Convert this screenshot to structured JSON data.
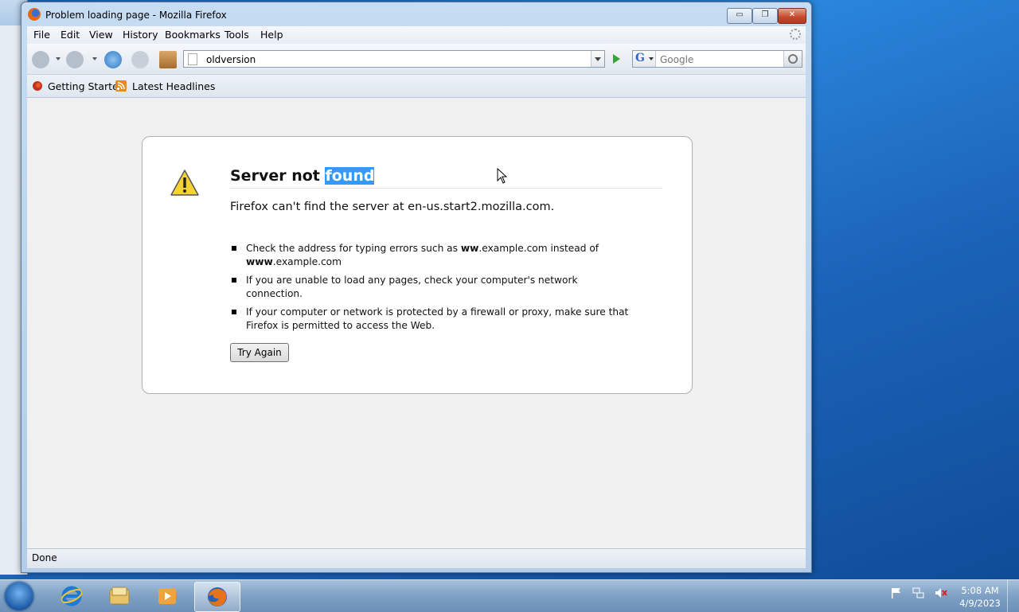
{
  "window": {
    "title": "Problem loading page - Mozilla Firefox",
    "controls": {
      "minimize": "▭",
      "maximize": "❐",
      "close": "✕"
    }
  },
  "menubar": {
    "items": [
      "File",
      "Edit",
      "View",
      "History",
      "Bookmarks",
      "Tools",
      "Help"
    ]
  },
  "navbar": {
    "url": "oldversion",
    "search_placeholder": "Google",
    "search_engine_icon": "google-icon"
  },
  "bookmarks": {
    "items": [
      {
        "label": "Getting Started",
        "icon": "firefox-bookmark-icon"
      },
      {
        "label": "Latest Headlines",
        "icon": "rss-icon"
      }
    ]
  },
  "error": {
    "title_prefix": "Server not ",
    "title_selected": "found",
    "message": "Firefox can't find the server at en-us.start2.mozilla.com.",
    "bullet1_pre": "Check the address for typing errors such as ",
    "bullet1_b1": "ww",
    "bullet1_mid": ".example.com instead of ",
    "bullet1_b2": "www",
    "bullet1_post": ".example.com",
    "bullet2": "If you are unable to load any pages, check your computer's network connection.",
    "bullet3": "If your computer or network is protected by a firewall or proxy, make sure that Firefox is permitted to access the Web.",
    "button": "Try Again"
  },
  "status": {
    "text": "Done"
  },
  "taskbar": {
    "apps": [
      "internet-explorer-icon",
      "windows-explorer-icon",
      "media-player-icon",
      "firefox-icon"
    ],
    "active_app": "firefox-icon",
    "tray_icons": [
      "action-center-flag-icon",
      "network-icon",
      "volume-muted-icon"
    ],
    "time": "5:08 AM",
    "date": "4/9/2023"
  },
  "colors": {
    "selection": "#3399ff",
    "close_button": "#c3472b",
    "desktop": "#1e6fc9"
  }
}
